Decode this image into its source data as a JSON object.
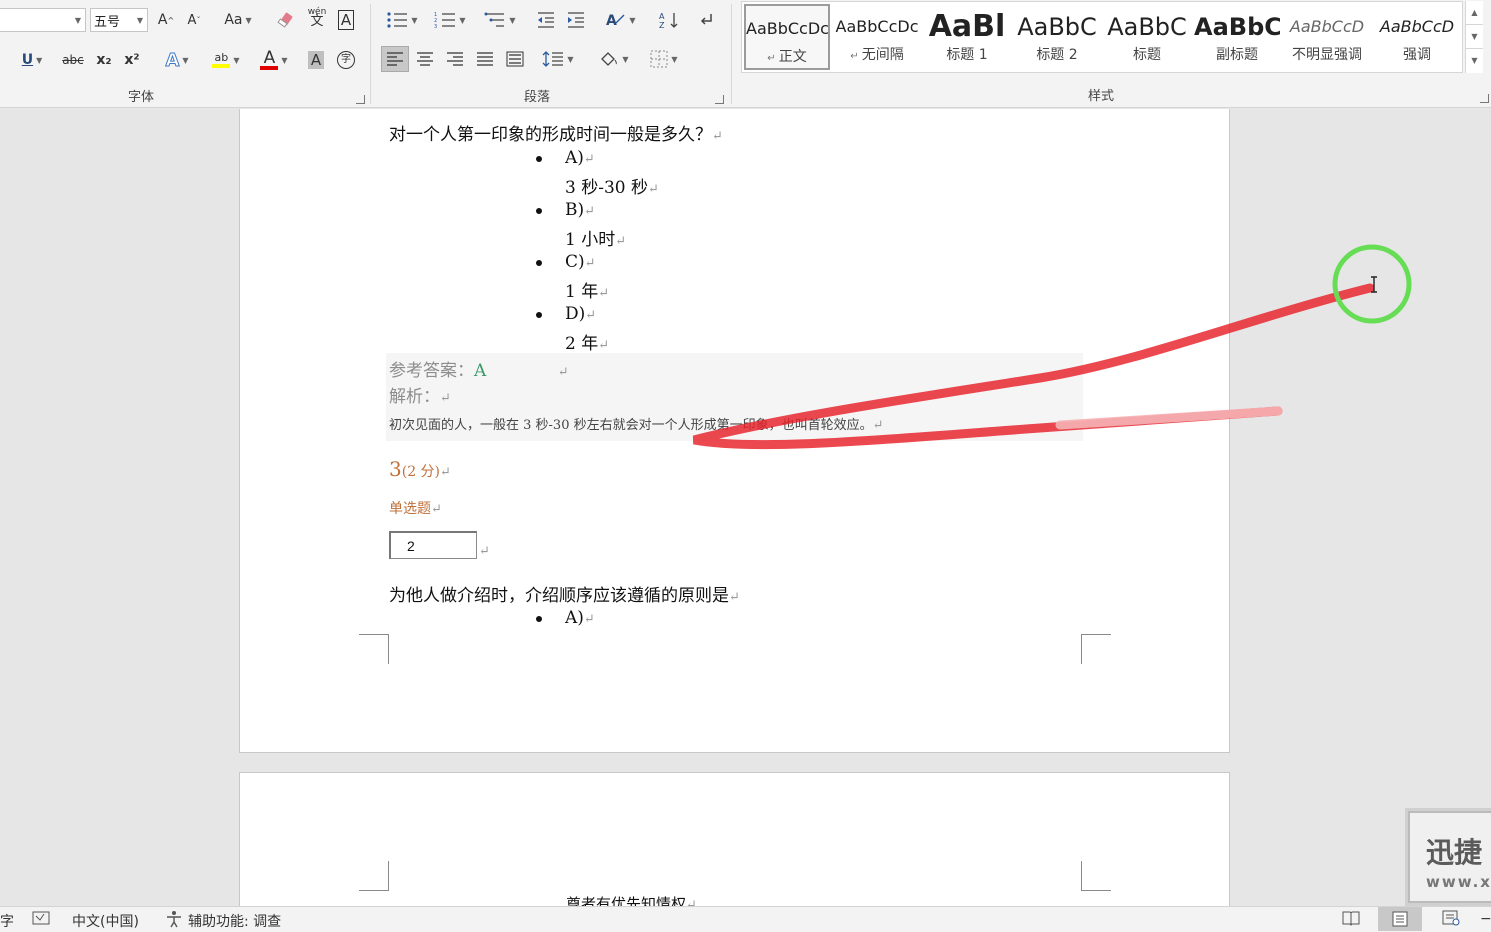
{
  "ribbon": {
    "font_group": {
      "label": "字体",
      "font_size": "五号",
      "grow_font": "A",
      "shrink_font": "A",
      "change_case": "Aa",
      "phonetic": "文",
      "phonetic_top": "wén",
      "char_border": "A",
      "underline": "U",
      "strikethrough": "abc",
      "subscript": "x₂",
      "superscript": "x²",
      "text_effects": "A",
      "highlight": "ab",
      "font_color": "A",
      "char_shading": "A",
      "enclose": "字"
    },
    "paragraph_group": {
      "label": "段落"
    },
    "styles_group": {
      "label": "样式",
      "items": [
        {
          "sample": "AaBbCcDc",
          "name": "正文"
        },
        {
          "sample": "AaBbCcDc",
          "name": "无间隔"
        },
        {
          "sample": "AaBl",
          "name": "标题 1"
        },
        {
          "sample": "AaBbC",
          "name": "标题 2"
        },
        {
          "sample": "AaBbC",
          "name": "标题"
        },
        {
          "sample": "AaBbC",
          "name": "副标题"
        },
        {
          "sample": "AaBbCcD",
          "name": "不明显强调"
        },
        {
          "sample": "AaBbCcD",
          "name": "强调"
        }
      ]
    }
  },
  "document": {
    "q2": {
      "question": "对一个人第一印象的形成时间一般是多久？",
      "options": [
        {
          "letter": "A)",
          "text": "3 秒-30 秒"
        },
        {
          "letter": "B)",
          "text": "1 小时"
        },
        {
          "letter": "C)",
          "text": "1 年"
        },
        {
          "letter": "D)",
          "text": "2 年"
        }
      ],
      "answer_label": "参考答案：",
      "answer_value": "A",
      "analysis_label": "解析：",
      "analysis_text": "初次见面的人，一般在 3 秒-30 秒左右就会对一个人形成第一印象，也叫首轮效应。"
    },
    "q3": {
      "number": "3",
      "points": "(2 分)",
      "type": "单选题",
      "input_value": "2",
      "question": "为他人做介绍时，介绍顺序应该遵循的原则是",
      "first_option": "A)"
    },
    "page2_text": "尊者有优先知情权"
  },
  "para_mark": "↵",
  "statusbar": {
    "words": "字",
    "language": "中文(中国)",
    "accessibility": "辅助功能: 调查"
  },
  "watermark": {
    "title": "迅捷",
    "url": "www.x"
  }
}
